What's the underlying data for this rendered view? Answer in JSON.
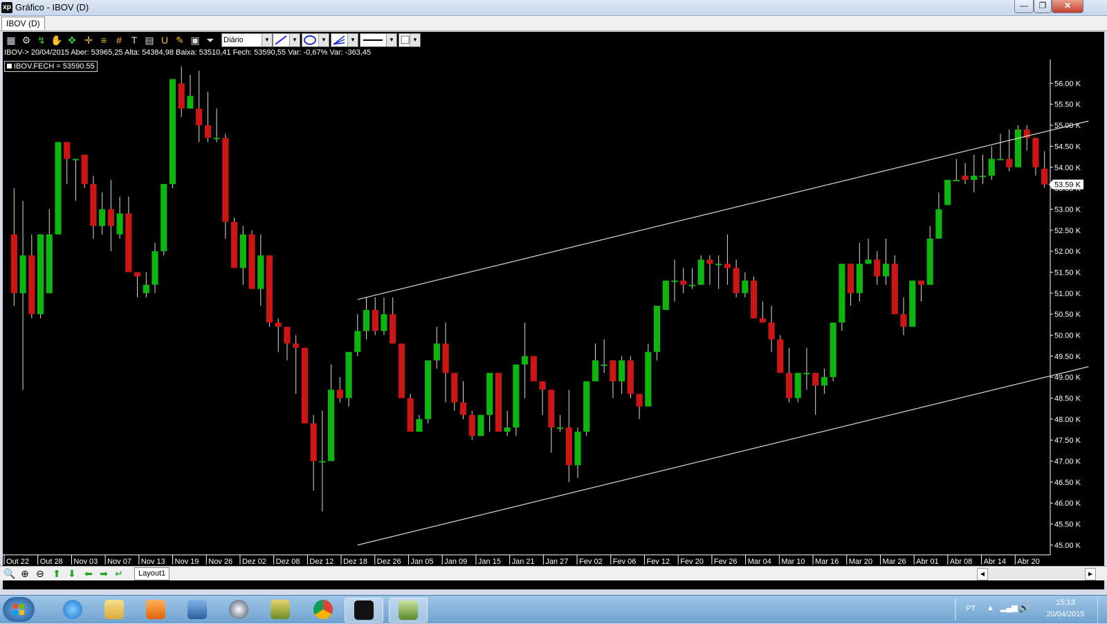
{
  "window": {
    "title": "Gráfico - IBOV (D)",
    "app_icon_label": "xp",
    "minimize_label": "—",
    "maximize_label": "❐",
    "close_label": "✕"
  },
  "tab": {
    "label": "IBOV (D)"
  },
  "toolbar": {
    "period_select": "Diário",
    "icons": [
      "chart-type-icon",
      "settings-icon",
      "indicator-icon",
      "hand-icon",
      "zoom-cursor-icon",
      "crosshair-icon",
      "horizontal-lines-icon",
      "grid-icon",
      "text-tool-icon",
      "calculator-icon",
      "magnet-icon",
      "pen-icon",
      "lock-icon",
      "filter-icon"
    ]
  },
  "info_line": "IBOV-> 20/04/2015 Aber: 53965,25 Alta: 54384,98 Baixa: 53510,41 Fech: 53590,55 Var: -0,67% Var: -363,45",
  "legend": "IBOV.FECH = 53590.55",
  "colors": {
    "up": "#0fb50f",
    "down": "#cc1515",
    "background": "#000000",
    "wick": "#dddddd",
    "trendline": "#d8d8d8"
  },
  "chart_data": {
    "type": "candlestick",
    "title": "",
    "ylim": [
      44800,
      56600
    ],
    "y_ticks": [
      "45.00 K",
      "45.50 K",
      "46.00 K",
      "46.50 K",
      "47.00 K",
      "47.50 K",
      "48.00 K",
      "48.50 K",
      "49.00 K",
      "49.50 K",
      "50.00 K",
      "50.50 K",
      "51.00 K",
      "51.50 K",
      "52.00 K",
      "52.50 K",
      "53.00 K",
      "53.50 K",
      "54.00 K",
      "54.50 K",
      "55.00 K",
      "55.50 K",
      "56.00 K"
    ],
    "y_tick_values": [
      45000,
      45500,
      46000,
      46500,
      47000,
      47500,
      48000,
      48500,
      49000,
      49500,
      50000,
      50500,
      51000,
      51500,
      52000,
      52500,
      53000,
      53500,
      54000,
      54500,
      55000,
      55500,
      56000
    ],
    "x_labels": [
      "Out 22",
      "Out 28",
      "Nov 03",
      "Nov 07",
      "Nov 13",
      "Nov 19",
      "Nov 26",
      "Dez 02",
      "Dez 08",
      "Dez 12",
      "Dez 18",
      "Dez 26",
      "Jan 05",
      "Jan 09",
      "Jan 15",
      "Jan 21",
      "Jan 27",
      "Fev 02",
      "Fev 06",
      "Fev 12",
      "Fev 20",
      "Fev 26",
      "Mar 04",
      "Mar 10",
      "Mar 16",
      "Mar 20",
      "Mar 26",
      "Abr 01",
      "Abr 08",
      "Abr 14",
      "Abr 20"
    ],
    "last_price_label": "53.59 K",
    "last_price": 53590.55,
    "candles": [
      [
        52400,
        53500,
        50700,
        51000
      ],
      [
        51000,
        53200,
        48700,
        51900
      ],
      [
        51900,
        52400,
        50400,
        50500
      ],
      [
        50500,
        52400,
        50400,
        52400
      ],
      [
        51000,
        53000,
        51000,
        52400
      ],
      [
        52400,
        54600,
        52400,
        54600
      ],
      [
        54600,
        54600,
        53600,
        54200
      ],
      [
        54200,
        54200,
        53200,
        54200
      ],
      [
        54300,
        54300,
        53500,
        53600
      ],
      [
        53600,
        53800,
        52300,
        52600
      ],
      [
        52600,
        53400,
        52400,
        53000
      ],
      [
        53000,
        53700,
        52000,
        52600
      ],
      [
        52400,
        53300,
        52300,
        52900
      ],
      [
        52900,
        53300,
        51600,
        51500
      ],
      [
        51500,
        51500,
        50900,
        51400
      ],
      [
        51000,
        51500,
        50900,
        51200
      ],
      [
        51200,
        52200,
        51000,
        52000
      ],
      [
        52000,
        53600,
        51900,
        53600
      ],
      [
        53600,
        55700,
        53500,
        56100
      ],
      [
        56000,
        56400,
        55200,
        55400
      ],
      [
        55400,
        56200,
        55400,
        55700
      ],
      [
        55400,
        56300,
        54600,
        55000
      ],
      [
        55000,
        55800,
        54600,
        54700
      ],
      [
        54700,
        55400,
        54600,
        54700
      ],
      [
        54700,
        54800,
        52300,
        52700
      ],
      [
        52700,
        52800,
        51600,
        51600
      ],
      [
        51600,
        52600,
        51200,
        52400
      ],
      [
        52400,
        52500,
        51200,
        51100
      ],
      [
        51100,
        52400,
        50700,
        51900
      ],
      [
        51900,
        51900,
        50200,
        50300
      ],
      [
        50300,
        50400,
        49600,
        50200
      ],
      [
        50200,
        50200,
        49400,
        49800
      ],
      [
        49800,
        50000,
        48600,
        49700
      ],
      [
        49700,
        49700,
        47900,
        47900
      ],
      [
        47900,
        48100,
        46300,
        47000
      ],
      [
        47000,
        48200,
        45800,
        47000
      ],
      [
        47000,
        49300,
        47000,
        48700
      ],
      [
        48700,
        49000,
        48400,
        48500
      ],
      [
        48500,
        49600,
        48300,
        49600
      ],
      [
        49600,
        50500,
        49500,
        50100
      ],
      [
        50100,
        50900,
        49900,
        50600
      ],
      [
        50600,
        50900,
        50000,
        50100
      ],
      [
        50100,
        50900,
        50000,
        50500
      ],
      [
        50500,
        50900,
        49800,
        49800
      ],
      [
        49800,
        49800,
        48500,
        48500
      ],
      [
        48500,
        48600,
        47700,
        47700
      ],
      [
        47700,
        48100,
        47700,
        48000
      ],
      [
        48000,
        48800,
        47900,
        49400
      ],
      [
        49400,
        50200,
        49200,
        49800
      ],
      [
        49800,
        50300,
        48400,
        49100
      ],
      [
        49100,
        49100,
        48200,
        48400
      ],
      [
        48400,
        48900,
        48000,
        48100
      ],
      [
        48100,
        48200,
        47500,
        47600
      ],
      [
        47600,
        48100,
        47600,
        48100
      ],
      [
        48100,
        49100,
        47700,
        49100
      ],
      [
        49100,
        49100,
        47700,
        47700
      ],
      [
        47700,
        48200,
        47600,
        47800
      ],
      [
        47800,
        49100,
        47600,
        49300
      ],
      [
        49300,
        50300,
        48500,
        49500
      ],
      [
        49500,
        49400,
        48900,
        48900
      ],
      [
        48900,
        48900,
        48100,
        48700
      ],
      [
        48700,
        48700,
        47200,
        47800
      ],
      [
        47800,
        48100,
        47700,
        47800
      ],
      [
        47800,
        48700,
        46500,
        46900
      ],
      [
        46900,
        47800,
        46600,
        47700
      ],
      [
        47700,
        48600,
        47600,
        48900
      ],
      [
        48900,
        49800,
        48900,
        49400
      ],
      [
        49300,
        49900,
        49100,
        49300
      ],
      [
        49400,
        49400,
        48500,
        48900
      ],
      [
        48900,
        49500,
        48600,
        49400
      ],
      [
        49400,
        49500,
        48500,
        48600
      ],
      [
        48600,
        48600,
        48000,
        48300
      ],
      [
        48300,
        49800,
        48300,
        49600
      ],
      [
        49600,
        50700,
        49400,
        50700
      ],
      [
        50600,
        51200,
        50600,
        51300
      ],
      [
        51300,
        51800,
        50800,
        51300
      ],
      [
        51300,
        51600,
        51000,
        51200
      ],
      [
        51200,
        51600,
        51100,
        51200
      ],
      [
        51200,
        51900,
        51200,
        51800
      ],
      [
        51800,
        51900,
        51200,
        51700
      ],
      [
        51700,
        51900,
        51100,
        51700
      ],
      [
        51700,
        52400,
        51200,
        51600
      ],
      [
        51600,
        51800,
        50900,
        51000
      ],
      [
        51000,
        51500,
        50900,
        51300
      ],
      [
        51300,
        51400,
        50400,
        50400
      ],
      [
        50400,
        50800,
        50300,
        50300
      ],
      [
        50300,
        50700,
        49600,
        49900
      ],
      [
        49900,
        50000,
        49100,
        49100
      ],
      [
        49100,
        49700,
        48400,
        48500
      ],
      [
        48500,
        49000,
        48400,
        49100
      ],
      [
        49100,
        49700,
        48700,
        49100
      ],
      [
        49100,
        49100,
        48100,
        48800
      ],
      [
        48800,
        49200,
        48600,
        49000
      ],
      [
        49000,
        50300,
        48900,
        50300
      ],
      [
        50300,
        51600,
        50100,
        51700
      ],
      [
        51700,
        51700,
        50700,
        51000
      ],
      [
        51000,
        52200,
        50800,
        51700
      ],
      [
        51700,
        52300,
        51700,
        51800
      ],
      [
        51800,
        52000,
        51200,
        51400
      ],
      [
        51400,
        52300,
        51200,
        51700
      ],
      [
        51700,
        51900,
        50500,
        50500
      ],
      [
        50500,
        50900,
        50000,
        50200
      ],
      [
        50200,
        51300,
        50200,
        51300
      ],
      [
        51300,
        51200,
        50800,
        51200
      ],
      [
        51200,
        52600,
        51200,
        52300
      ],
      [
        52300,
        53400,
        52300,
        53000
      ],
      [
        53100,
        53700,
        53100,
        53700
      ],
      [
        53700,
        54200,
        53700,
        53700
      ],
      [
        53800,
        54100,
        53600,
        53700
      ],
      [
        53700,
        54300,
        53400,
        53800
      ],
      [
        53800,
        54300,
        53600,
        53800
      ],
      [
        53800,
        54500,
        53700,
        54200
      ],
      [
        54200,
        54800,
        54200,
        54200
      ],
      [
        54200,
        54900,
        53900,
        54000
      ],
      [
        54000,
        55000,
        54000,
        54900
      ],
      [
        54900,
        55000,
        54400,
        54700
      ],
      [
        54700,
        54700,
        53800,
        54000
      ],
      [
        53965,
        54385,
        53510,
        53590
      ]
    ]
  },
  "bottom": {
    "layout_tab": "Layout1",
    "icons": [
      "zoom-fit-icon",
      "zoom-in-icon",
      "zoom-out-icon",
      "arrow-up-icon",
      "arrow-down-icon",
      "arrow-left-icon",
      "arrow-right-icon",
      "scroll-end-icon"
    ]
  },
  "taskbar": {
    "language": "PT",
    "time": "15:13",
    "date": "20/04/2015"
  }
}
